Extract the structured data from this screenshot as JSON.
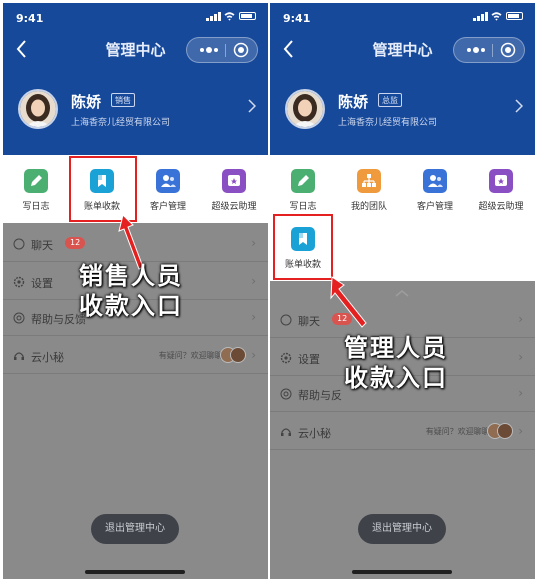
{
  "colors": {
    "header_bg": "#17499a",
    "highlight": "#e52020",
    "write_log_icon": "#4caf72",
    "billing_icon": "#1aa1d6",
    "customer_icon": "#3a73d8",
    "assistant_icon": "#8a4fc2",
    "team_icon": "#ee9a3d",
    "unread_badge": "#d9534f"
  },
  "screens": [
    {
      "status_time": "9:41",
      "title": "管理中心",
      "user_name": "陈娇",
      "role_badge": "销售",
      "company": "上海香奈儿经贸有限公司",
      "tiles": [
        {
          "label": "写日志",
          "icon": "pencil-icon"
        },
        {
          "label": "账单收款",
          "icon": "bill-icon"
        },
        {
          "label": "客户管理",
          "icon": "contacts-icon"
        },
        {
          "label": "超级云助理",
          "icon": "assistant-icon"
        }
      ],
      "menu": [
        {
          "label": "聊天",
          "badge": "12",
          "icon": "chat-icon"
        },
        {
          "label": "设置",
          "icon": "settings-icon"
        },
        {
          "label": "帮助与反馈",
          "icon": "help-icon"
        },
        {
          "label": "云小秘",
          "hint": "有疑问？欢迎聊聊!",
          "icon": "headset-icon"
        }
      ],
      "logout_label": "退出管理中心",
      "callout_line1": "销售人员",
      "callout_line2": "收款入口"
    },
    {
      "status_time": "9:41",
      "title": "管理中心",
      "user_name": "陈娇",
      "role_badge": "总监",
      "company": "上海香奈儿经贸有限公司",
      "tiles": [
        {
          "label": "写日志",
          "icon": "pencil-icon"
        },
        {
          "label": "我的团队",
          "icon": "team-icon"
        },
        {
          "label": "客户管理",
          "icon": "contacts-icon"
        },
        {
          "label": "超级云助理",
          "icon": "assistant-icon"
        },
        {
          "label": "账单收款",
          "icon": "bill-icon"
        }
      ],
      "menu": [
        {
          "label": "聊天",
          "badge": "12",
          "icon": "chat-icon"
        },
        {
          "label": "设置",
          "icon": "settings-icon"
        },
        {
          "label": "帮助与反",
          "icon": "help-icon"
        },
        {
          "label": "云小秘",
          "hint": "有疑问？欢迎聊聊!",
          "icon": "headset-icon"
        }
      ],
      "logout_label": "退出管理中心",
      "callout_line1": "管理人员",
      "callout_line2": "收款入口"
    }
  ]
}
